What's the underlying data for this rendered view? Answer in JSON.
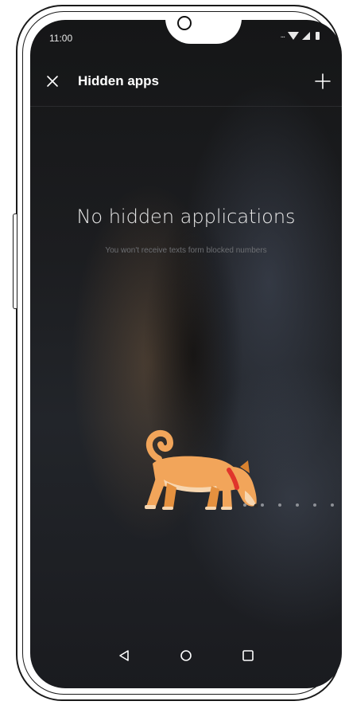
{
  "status_bar": {
    "time": "11:00",
    "dots": "..."
  },
  "header": {
    "title": "Hidden apps",
    "close_icon": "close-icon",
    "add_icon": "plus-icon"
  },
  "empty_state": {
    "title": "No hidden applications",
    "subtitle": "You won't receive texts form blocked numbers",
    "illustration": "dog-illustration"
  },
  "nav_bar": {
    "back_icon": "back-triangle-icon",
    "home_icon": "home-circle-icon",
    "recents_icon": "recents-square-icon"
  },
  "colors": {
    "background": "#1c1d20",
    "text_primary": "#ffffff",
    "text_secondary": "#6d6f73",
    "dog_body": "#f2a55a",
    "collar": "#e0352b"
  }
}
